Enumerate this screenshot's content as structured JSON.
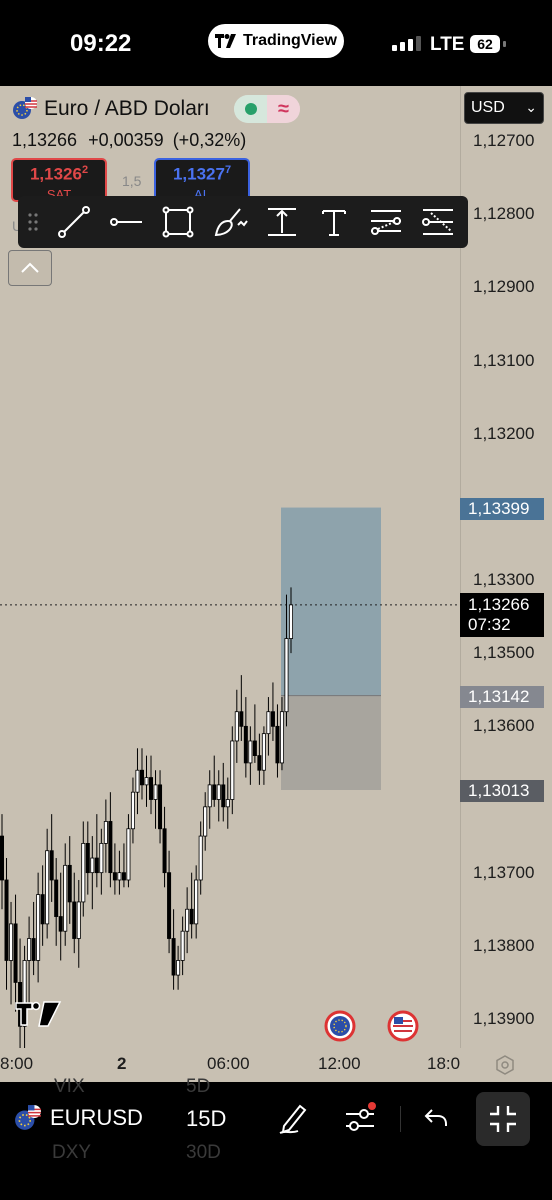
{
  "status_bar": {
    "time": "09:22",
    "app_pill": "TradingView",
    "network": "LTE",
    "battery": "62"
  },
  "header": {
    "symbol_title": "Euro / ABD Doları",
    "last_price": "1,13266",
    "change": "+0,00359",
    "change_pct": "(+0,32%)",
    "currency": "USD",
    "sell": {
      "price_main": "1,1326",
      "price_sup": "2",
      "label": "SAT"
    },
    "buy": {
      "price_main": "1,1327",
      "price_sup": "7",
      "label": "AL"
    },
    "spread": "1,5",
    "hidden_letter": "U"
  },
  "drawing_tools": [
    {
      "name": "trend-line-icon"
    },
    {
      "name": "horizontal-ray-icon"
    },
    {
      "name": "rectangle-icon"
    },
    {
      "name": "brush-icon"
    },
    {
      "name": "price-range-icon"
    },
    {
      "name": "text-icon"
    },
    {
      "name": "fib-retracement-icon"
    },
    {
      "name": "position-tool-icon"
    }
  ],
  "price_axis": {
    "ticks": [
      "1,13900",
      "1,13800",
      "1,13700",
      "1,13600",
      "1,13500",
      "1,13300",
      "1,13200",
      "1,13100",
      "1,12900",
      "1,12800",
      "1,12700"
    ],
    "labels": {
      "target": "1,13399",
      "current": "1,13266",
      "countdown": "07:32",
      "entry": "1,13142",
      "stop": "1,13013"
    }
  },
  "time_axis": {
    "ticks": [
      "8:00",
      "2",
      "06:00",
      "12:00",
      "18:0"
    ]
  },
  "bottom_bar": {
    "symbol": "EURUSD",
    "interval": "15D",
    "ghost_items": [
      "VIX",
      "5D",
      "DXY",
      "30D"
    ]
  },
  "colors": {
    "chart_background": "#c8c0b2",
    "candle": "#000000",
    "target_zone": "#5f8aa8",
    "stop_zone": "#8e8e8e",
    "sell": "#e04848",
    "buy": "#3b62e0",
    "target_label": "#4a7396",
    "entry_label": "#858890"
  },
  "chart_data": {
    "type": "candlestick",
    "symbol": "EURUSD",
    "ylim": [
      1.1265,
      1.1397
    ],
    "y_ticks": [
      1.127,
      1.128,
      1.129,
      1.131,
      1.132,
      1.133,
      1.135,
      1.136,
      1.137,
      1.138,
      1.139
    ],
    "x_ticks": [
      "8:00",
      "2",
      "06:00",
      "12:00",
      "18:0"
    ],
    "last_price": 1.13266,
    "position": {
      "type": "long",
      "entry": 1.13142,
      "target": 1.13399,
      "stop": 1.13013
    },
    "candles": [
      [
        1.1295,
        1.1298,
        1.1285,
        1.1289
      ],
      [
        1.1289,
        1.1292,
        1.1274,
        1.1278
      ],
      [
        1.1278,
        1.1286,
        1.1272,
        1.1283
      ],
      [
        1.1283,
        1.1287,
        1.1271,
        1.1275
      ],
      [
        1.1275,
        1.1281,
        1.1266,
        1.1269
      ],
      [
        1.1269,
        1.128,
        1.1265,
        1.1278
      ],
      [
        1.1278,
        1.1284,
        1.1272,
        1.1281
      ],
      [
        1.1281,
        1.1286,
        1.1276,
        1.1278
      ],
      [
        1.1278,
        1.129,
        1.1275,
        1.1287
      ],
      [
        1.1287,
        1.1291,
        1.128,
        1.1283
      ],
      [
        1.1283,
        1.1296,
        1.1281,
        1.1293
      ],
      [
        1.1293,
        1.1298,
        1.1286,
        1.1289
      ],
      [
        1.1289,
        1.1292,
        1.128,
        1.1284
      ],
      [
        1.1284,
        1.129,
        1.1278,
        1.1282
      ],
      [
        1.1282,
        1.1294,
        1.128,
        1.1291
      ],
      [
        1.1291,
        1.1295,
        1.1283,
        1.1286
      ],
      [
        1.1286,
        1.129,
        1.1279,
        1.1281
      ],
      [
        1.1281,
        1.1289,
        1.1277,
        1.1286
      ],
      [
        1.1286,
        1.1297,
        1.1284,
        1.1294
      ],
      [
        1.1294,
        1.1297,
        1.1287,
        1.129
      ],
      [
        1.129,
        1.1295,
        1.1285,
        1.1292
      ],
      [
        1.1292,
        1.1298,
        1.1288,
        1.129
      ],
      [
        1.129,
        1.1296,
        1.1287,
        1.1294
      ],
      [
        1.1294,
        1.13,
        1.129,
        1.1297
      ],
      [
        1.1297,
        1.1301,
        1.1288,
        1.129
      ],
      [
        1.129,
        1.1294,
        1.1287,
        1.1289
      ],
      [
        1.1289,
        1.1293,
        1.1287,
        1.129
      ],
      [
        1.129,
        1.1294,
        1.1288,
        1.1289
      ],
      [
        1.1289,
        1.1298,
        1.1288,
        1.1296
      ],
      [
        1.1296,
        1.1303,
        1.1294,
        1.1301
      ],
      [
        1.1301,
        1.1307,
        1.1298,
        1.1304
      ],
      [
        1.1304,
        1.1307,
        1.13,
        1.1302
      ],
      [
        1.1302,
        1.1306,
        1.1299,
        1.1303
      ],
      [
        1.1303,
        1.1306,
        1.1298,
        1.13
      ],
      [
        1.13,
        1.1304,
        1.1296,
        1.1302
      ],
      [
        1.1302,
        1.1304,
        1.1294,
        1.1296
      ],
      [
        1.1296,
        1.1299,
        1.1288,
        1.129
      ],
      [
        1.129,
        1.1293,
        1.1279,
        1.1281
      ],
      [
        1.1281,
        1.1285,
        1.1274,
        1.1276
      ],
      [
        1.1276,
        1.128,
        1.1274,
        1.1278
      ],
      [
        1.1278,
        1.1284,
        1.1276,
        1.1282
      ],
      [
        1.1282,
        1.1288,
        1.1279,
        1.1285
      ],
      [
        1.1285,
        1.129,
        1.1281,
        1.1283
      ],
      [
        1.1283,
        1.1291,
        1.1281,
        1.1289
      ],
      [
        1.1289,
        1.1297,
        1.1287,
        1.1295
      ],
      [
        1.1295,
        1.1301,
        1.1293,
        1.1299
      ],
      [
        1.1299,
        1.1304,
        1.1296,
        1.1302
      ],
      [
        1.1302,
        1.1306,
        1.1299,
        1.13
      ],
      [
        1.13,
        1.1304,
        1.1297,
        1.1302
      ],
      [
        1.1302,
        1.1305,
        1.1297,
        1.1299
      ],
      [
        1.1299,
        1.1303,
        1.1296,
        1.13
      ],
      [
        1.13,
        1.131,
        1.1298,
        1.1308
      ],
      [
        1.1308,
        1.1315,
        1.1305,
        1.1312
      ],
      [
        1.1312,
        1.1317,
        1.1308,
        1.131
      ],
      [
        1.131,
        1.1314,
        1.1303,
        1.1305
      ],
      [
        1.1305,
        1.131,
        1.1302,
        1.1308
      ],
      [
        1.1308,
        1.1313,
        1.1305,
        1.1306
      ],
      [
        1.1306,
        1.1309,
        1.1302,
        1.1304
      ],
      [
        1.1304,
        1.131,
        1.1302,
        1.1309
      ],
      [
        1.1309,
        1.1314,
        1.1306,
        1.1312
      ],
      [
        1.1312,
        1.1316,
        1.1308,
        1.131
      ],
      [
        1.131,
        1.1313,
        1.1303,
        1.1305
      ],
      [
        1.1305,
        1.1314,
        1.1304,
        1.1312
      ],
      [
        1.1312,
        1.1328,
        1.131,
        1.1322
      ],
      [
        1.1322,
        1.1329,
        1.132,
        1.13266
      ]
    ]
  }
}
